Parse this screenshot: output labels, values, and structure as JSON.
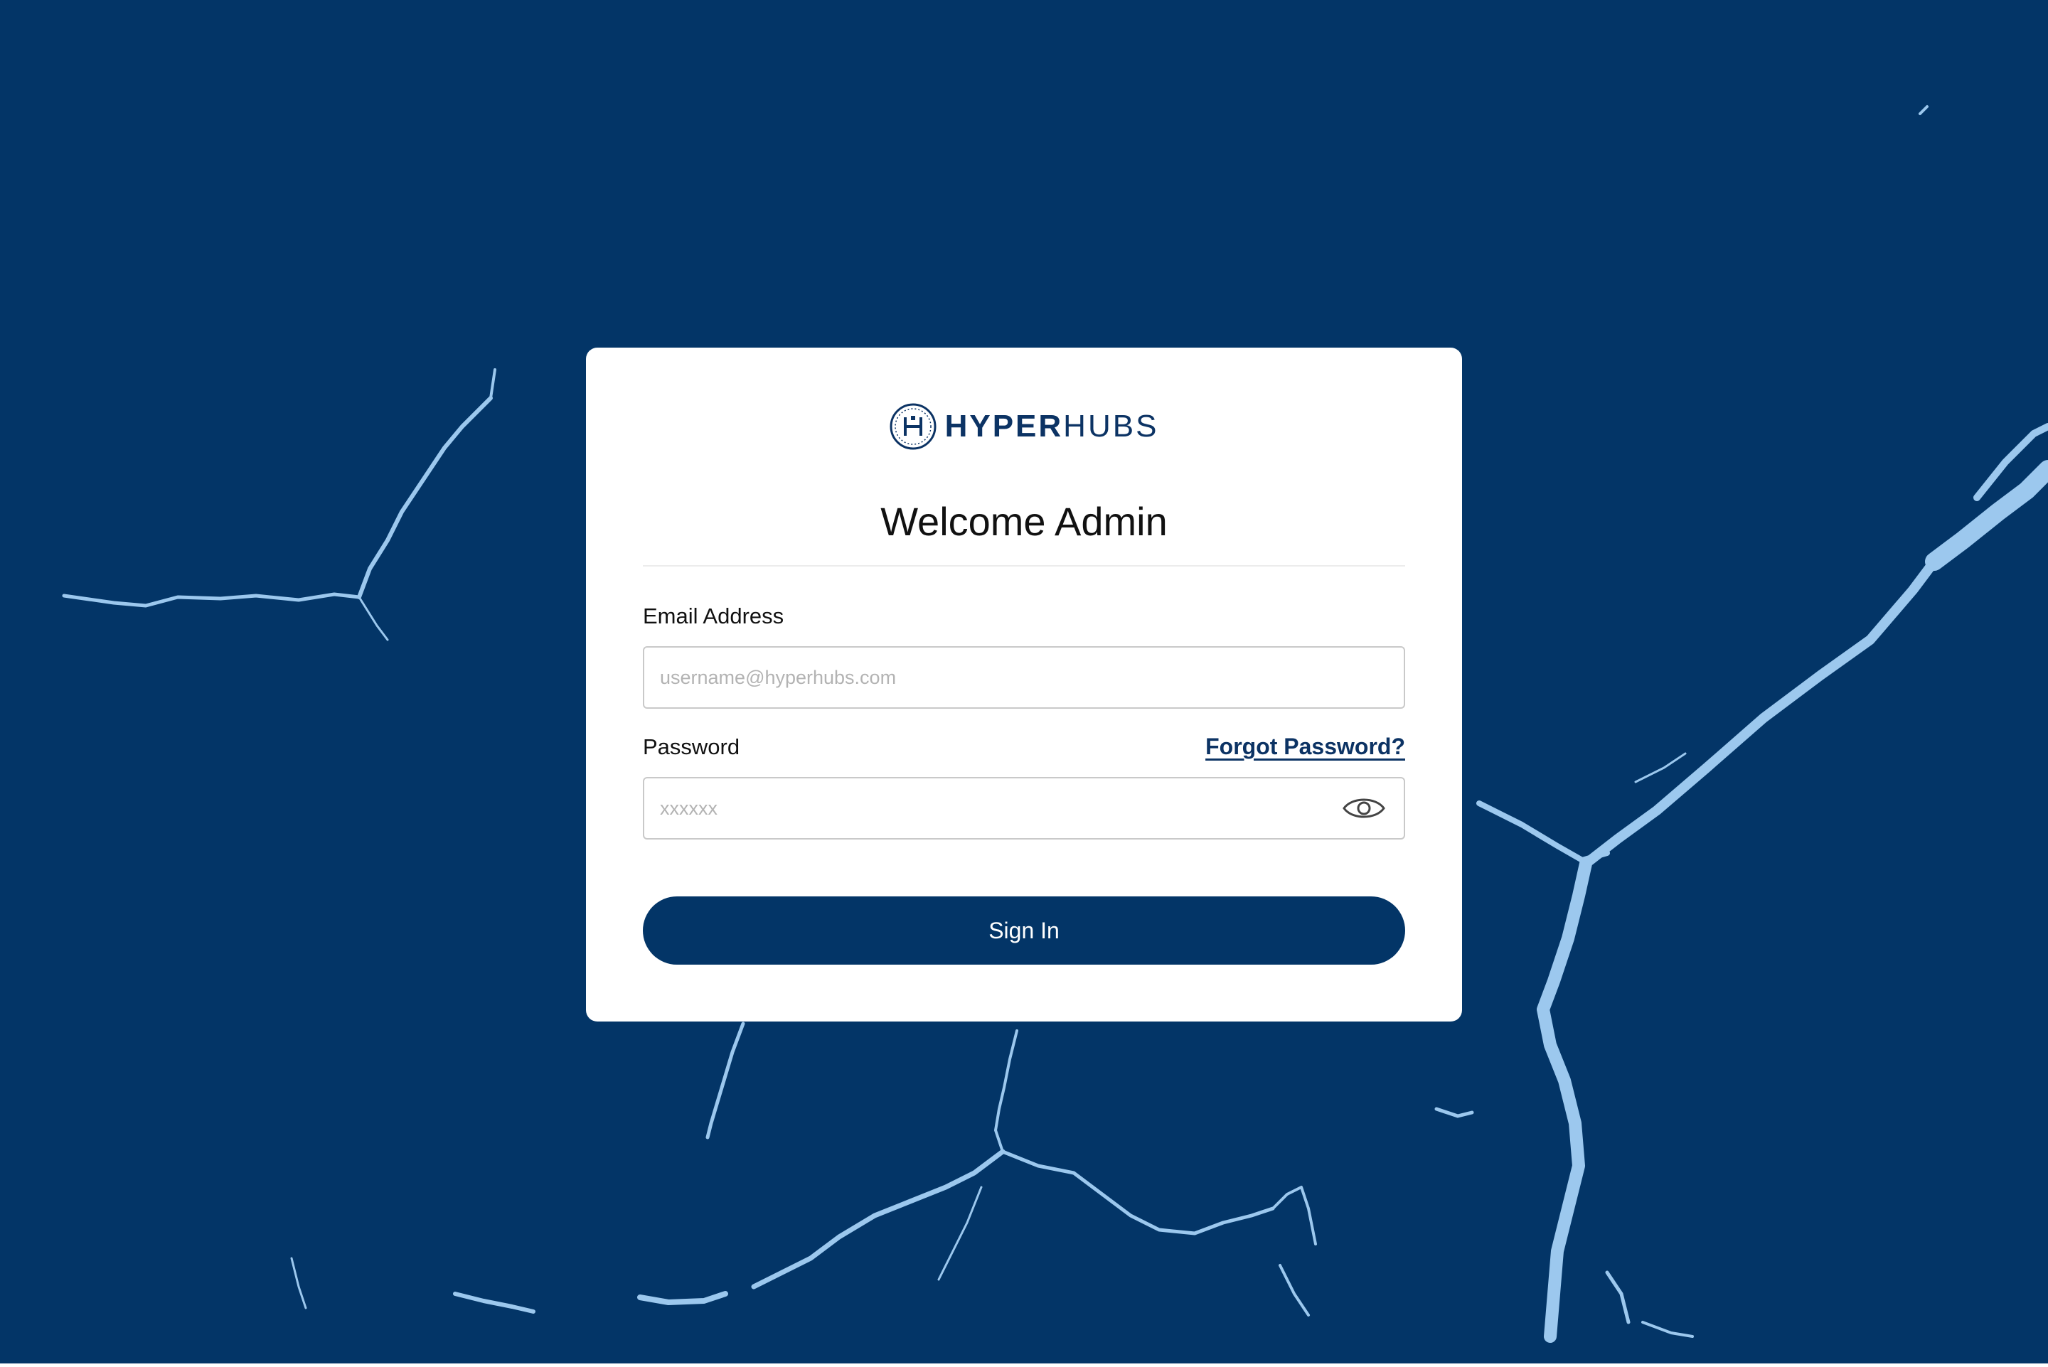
{
  "brand": {
    "name_bold": "HYPER",
    "name_light": "HUBS",
    "logo_icon": "hyperhubs-seal-icon"
  },
  "page": {
    "title": "Welcome Admin"
  },
  "form": {
    "email_label": "Email Address",
    "email_placeholder": "username@hyperhubs.com",
    "password_label": "Password",
    "password_placeholder": "xxxxxx",
    "forgot_label": "Forgot Password?",
    "show_password_icon": "eye-icon",
    "submit_label": "Sign In"
  },
  "colors": {
    "brand_navy": "#033567",
    "background": "#033567",
    "card": "#ffffff",
    "crack_highlight": "#a9d0f2"
  }
}
